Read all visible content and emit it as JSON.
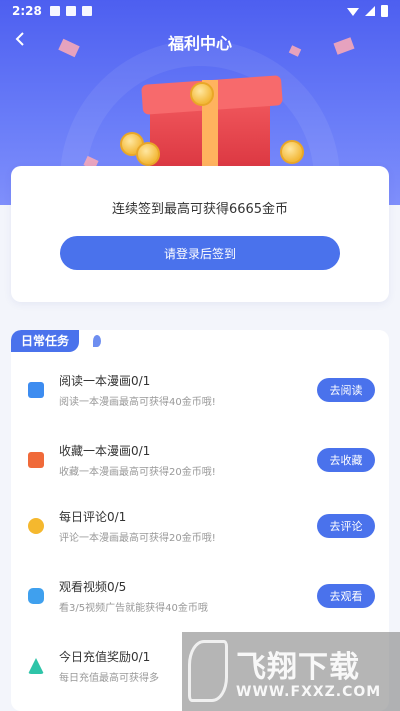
{
  "status_bar": {
    "time": "2:28"
  },
  "header": {
    "back_icon": "back-chevron-icon",
    "title": "福利中心"
  },
  "signin": {
    "message": "连续签到最高可获得6665金币",
    "button_label": "请登录后签到"
  },
  "tasks": {
    "section_title": "日常任务",
    "items": [
      {
        "name": "阅读一本漫画0/1",
        "desc": "阅读一本漫画最高可获得40金币哦!",
        "button": "去阅读",
        "icon": "book-icon",
        "icon_color": "#3d8cf0"
      },
      {
        "name": "收藏一本漫画0/1",
        "desc": "收藏一本漫画最高可获得20金币哦!",
        "button": "去收藏",
        "icon": "favorite-icon",
        "icon_color": "#f06a3a"
      },
      {
        "name": "每日评论0/1",
        "desc": "评论一本漫画最高可获得20金币哦!",
        "button": "去评论",
        "icon": "comment-icon",
        "icon_color": "#f5b82e"
      },
      {
        "name": "观看视频0/5",
        "desc": "看3/5视频广告就能获得40金币哦",
        "button": "去观看",
        "icon": "video-icon",
        "icon_color": "#3fa0ee"
      },
      {
        "name": "今日充值奖励0/1",
        "desc": "每日充值最高可获得多",
        "button": "",
        "icon": "recharge-icon",
        "icon_color": "#2ec4a8"
      }
    ]
  },
  "watermark": {
    "cn": "飞翔下载",
    "url": "WWW.FXXZ.COM"
  },
  "colors": {
    "primary": "#4a72ec",
    "header_bg": "#4d5ff0"
  }
}
